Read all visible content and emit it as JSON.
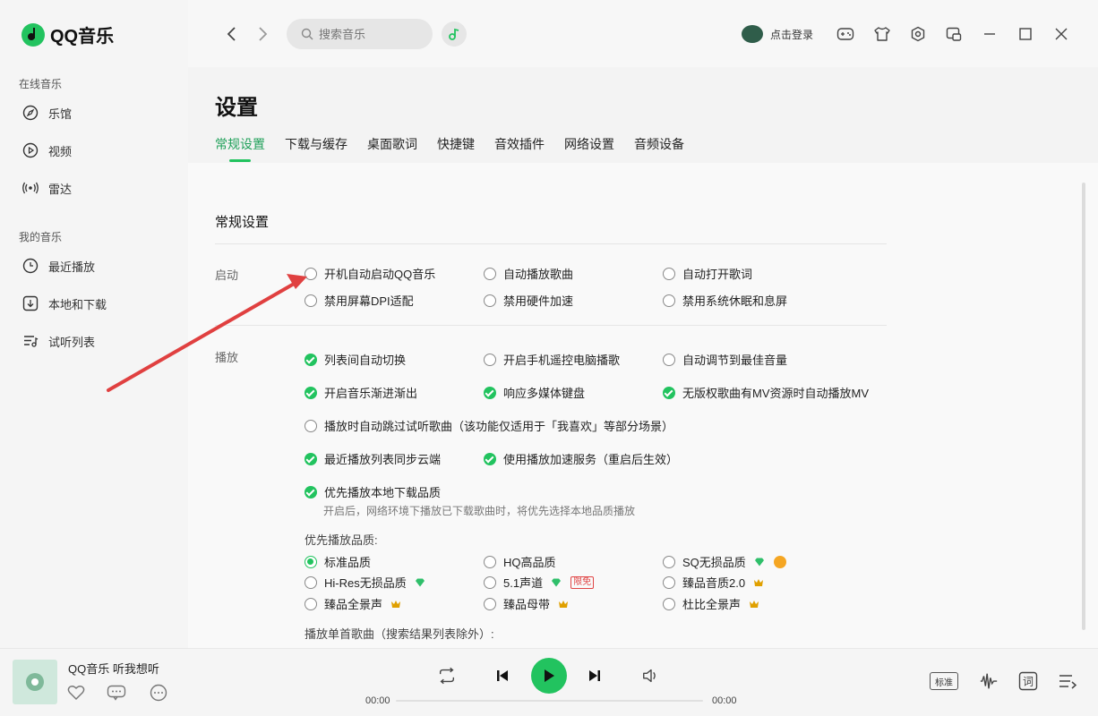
{
  "app": {
    "name": "QQ音乐"
  },
  "sidebar": {
    "section_online": "在线音乐",
    "online_items": [
      {
        "label": "乐馆",
        "icon": "compass-icon"
      },
      {
        "label": "视频",
        "icon": "video-icon"
      },
      {
        "label": "雷达",
        "icon": "radar-icon"
      }
    ],
    "section_mine": "我的音乐",
    "mine_items": [
      {
        "label": "最近播放",
        "icon": "clock-icon"
      },
      {
        "label": "本地和下载",
        "icon": "download-icon"
      },
      {
        "label": "试听列表",
        "icon": "playlist-icon"
      }
    ]
  },
  "titlebar": {
    "search_placeholder": "搜索音乐",
    "login_label": "点击登录"
  },
  "settings": {
    "title": "设置",
    "tabs": [
      "常规设置",
      "下载与缓存",
      "桌面歌词",
      "快捷键",
      "音效插件",
      "网络设置",
      "音频设备"
    ],
    "section_title": "常规设置",
    "startup": {
      "label": "启动",
      "options": [
        {
          "label": "开机自动启动QQ音乐",
          "checked": false
        },
        {
          "label": "自动播放歌曲",
          "checked": false
        },
        {
          "label": "自动打开歌词",
          "checked": false
        },
        {
          "label": "禁用屏幕DPI适配",
          "checked": false
        },
        {
          "label": "禁用硬件加速",
          "checked": false
        },
        {
          "label": "禁用系统休眠和息屏",
          "checked": false
        }
      ]
    },
    "playback": {
      "label": "播放",
      "options": [
        {
          "label": "列表间自动切换",
          "checked": true
        },
        {
          "label": "开启手机遥控电脑播歌",
          "checked": false
        },
        {
          "label": "自动调节到最佳音量",
          "checked": false
        },
        {
          "label": "开启音乐渐进渐出",
          "checked": true
        },
        {
          "label": "响应多媒体键盘",
          "checked": true
        },
        {
          "label": "无版权歌曲有MV资源时自动播放MV",
          "checked": true
        },
        {
          "label": "播放时自动跳过试听歌曲（该功能仅适用于「我喜欢」等部分场景）",
          "checked": false
        },
        {
          "label": "最近播放列表同步云端",
          "checked": true
        },
        {
          "label": "使用播放加速服务（重启后生效）",
          "checked": true
        },
        {
          "label": "优先播放本地下载品质",
          "checked": true
        }
      ],
      "local_quality_hint": "开启后，网络环境下播放已下载歌曲时，将优先选择本地品质播放",
      "quality_label": "优先播放品质:",
      "qualities": [
        {
          "label": "标准品质",
          "selected": true
        },
        {
          "label": "HQ高品质",
          "selected": false
        },
        {
          "label": "SQ无损品质",
          "selected": false
        },
        {
          "label": "Hi-Res无损品质",
          "selected": false
        },
        {
          "label": "5.1声道",
          "selected": false,
          "badge": "限免"
        },
        {
          "label": "臻品音质2.0",
          "selected": false
        },
        {
          "label": "臻品全景声",
          "selected": false
        },
        {
          "label": "臻品母带",
          "selected": false
        },
        {
          "label": "杜比全景声",
          "selected": false
        }
      ],
      "single_song_label": "播放单首歌曲（搜索结果列表除外）:"
    }
  },
  "player": {
    "song_title": "QQ音乐 听我想听",
    "time_current": "00:00",
    "time_total": "00:00",
    "quality_button": "标准",
    "lyrics_button": "词",
    "accent_color": "#22c35f"
  }
}
